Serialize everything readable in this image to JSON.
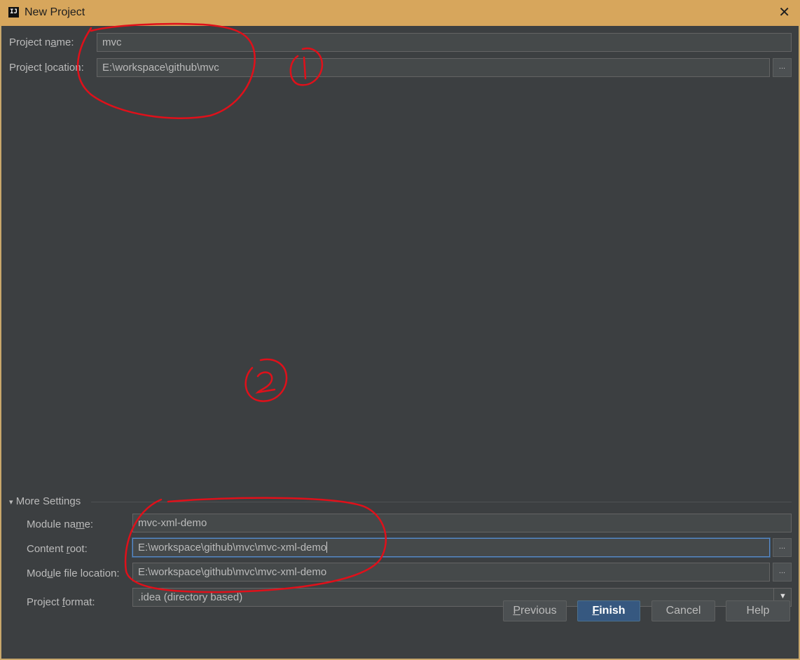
{
  "window": {
    "title": "New Project",
    "app_icon_text": "IJ"
  },
  "project": {
    "name_label_pre": "Project n",
    "name_label_ul": "a",
    "name_label_post": "me:",
    "name_value": "mvc",
    "location_label_pre": "Project ",
    "location_label_ul": "l",
    "location_label_post": "ocation:",
    "location_value": "E:\\workspace\\github\\mvc",
    "browse_label": "..."
  },
  "more_settings": {
    "toggle_glyph": "▾",
    "title": "More Settings",
    "module_name_label_pre": "Module na",
    "module_name_label_ul": "m",
    "module_name_label_post": "e:",
    "module_name_value": "mvc-xml-demo",
    "content_root_label_pre": "Content ",
    "content_root_label_ul": "r",
    "content_root_label_post": "oot:",
    "content_root_value": "E:\\workspace\\github\\mvc\\mvc-xml-demo",
    "module_file_label_pre": "Mod",
    "module_file_label_ul": "u",
    "module_file_label_post": "le file location:",
    "module_file_value": "E:\\workspace\\github\\mvc\\mvc-xml-demo",
    "format_label_pre": "Project ",
    "format_label_ul": "f",
    "format_label_post": "ormat:",
    "format_value": ".idea (directory based)",
    "browse_label": "..."
  },
  "buttons": {
    "previous_ul": "P",
    "previous_rest": "revious",
    "finish_ul": "F",
    "finish_rest": "inish",
    "cancel": "Cancel",
    "help": "Help"
  },
  "colors": {
    "title_bar": "#d7a65c",
    "panel": "#3c3f41",
    "field": "#45494a",
    "primary_button": "#365880",
    "annotation": "#e0101a"
  },
  "annotations": {
    "mark_1": "1",
    "mark_2": "2"
  }
}
